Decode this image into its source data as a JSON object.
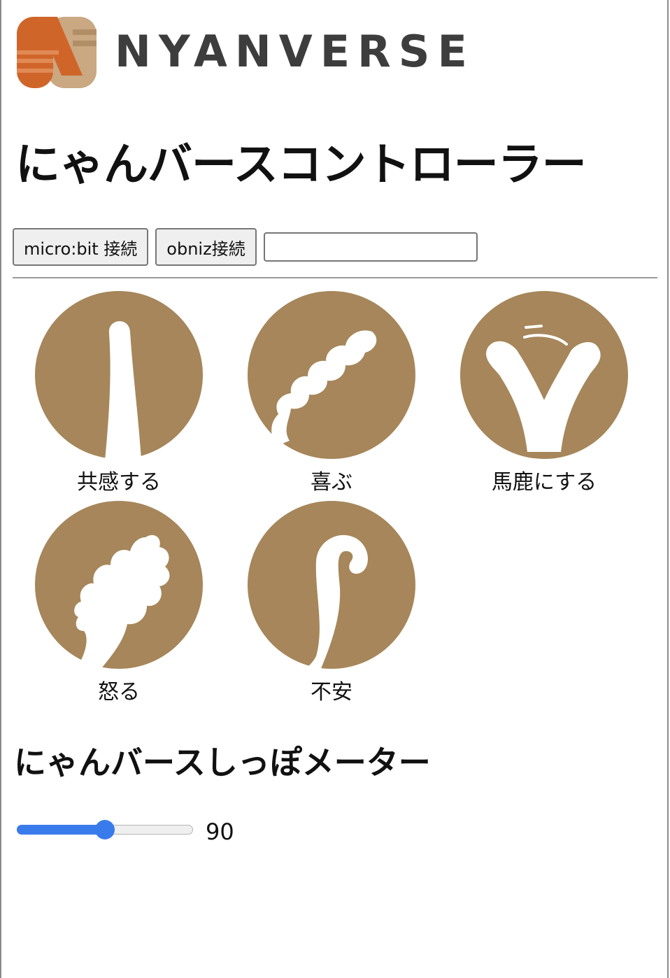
{
  "brand": {
    "name": "NYANVERSE",
    "logo_colors": {
      "orange": "#d0652a",
      "tan": "#c9a882"
    }
  },
  "page_title": "にゃんバースコントローラー",
  "toolbar": {
    "microbit_button": "micro:bit 接続",
    "obniz_button": "obniz接続",
    "id_input_value": ""
  },
  "emotions": [
    {
      "label": "共感する",
      "icon": "tail-straight-up-icon"
    },
    {
      "label": "喜ぶ",
      "icon": "tail-wavy-icon"
    },
    {
      "label": "馬鹿にする",
      "icon": "tail-v-shape-icon"
    },
    {
      "label": "怒る",
      "icon": "tail-puffed-icon"
    },
    {
      "label": "不安",
      "icon": "tail-hooked-icon"
    }
  ],
  "emotion_color": "#a6865a",
  "accent_color": "#3a7bec",
  "meter": {
    "title": "にゃんバースしっぽメーター",
    "value": "90",
    "min": 0,
    "max": 180
  }
}
